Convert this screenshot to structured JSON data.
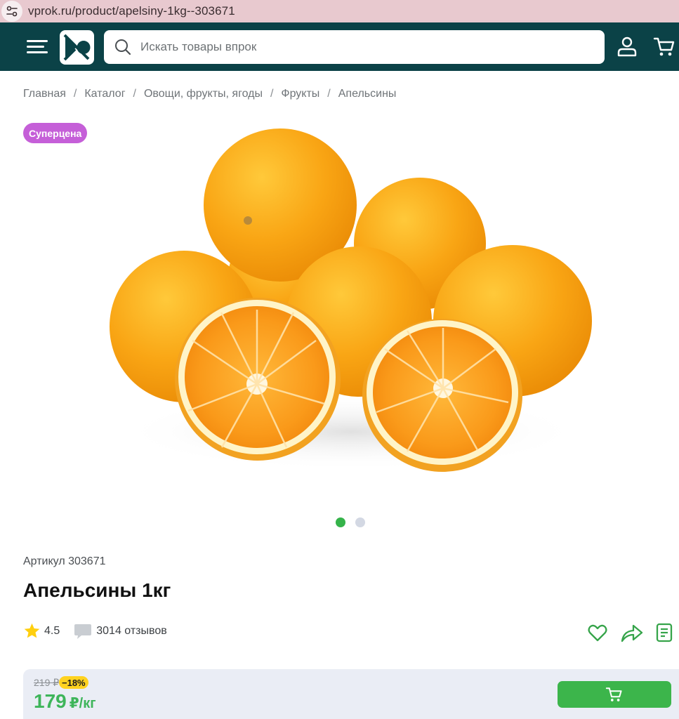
{
  "browser": {
    "url": "vprok.ru/product/apelsiny-1kg--303671"
  },
  "header": {
    "search_placeholder": "Искать товары впрок"
  },
  "breadcrumb": [
    "Главная",
    "Каталог",
    "Овощи, фрукты, ягоды",
    "Фрукты",
    "Апельсины"
  ],
  "breadcrumb_separator": "/",
  "product": {
    "badge": "Суперцена",
    "article": "Артикул 303671",
    "title": "Апельсины 1кг",
    "rating": "4.5",
    "reviews": "3014 отзывов",
    "gallery": {
      "total_images": 2,
      "active_index": 0
    }
  },
  "price": {
    "old": "219 ₽",
    "discount": "−18%",
    "current": "179",
    "unit": "₽/кг"
  },
  "colors": {
    "header_bg": "#0b4247",
    "accent_green": "#3cb54b",
    "price_green": "#3eb55a",
    "badge_purple": "#c55fd8",
    "discount_yellow": "#ffd21f",
    "dot_active": "#35b34a",
    "dot_inactive": "#d3d8e3"
  },
  "icons": {
    "url_bar": "site-settings-icon",
    "menu": "hamburger-menu-icon",
    "logo": "vprok-logo",
    "search": "search-icon",
    "account": "user-icon",
    "cart": "cart-icon",
    "rating": "star-icon",
    "reviews": "comment-icon",
    "favorite": "heart-icon",
    "share": "share-icon",
    "notes": "document-icon",
    "add_to_cart": "cart-icon"
  }
}
